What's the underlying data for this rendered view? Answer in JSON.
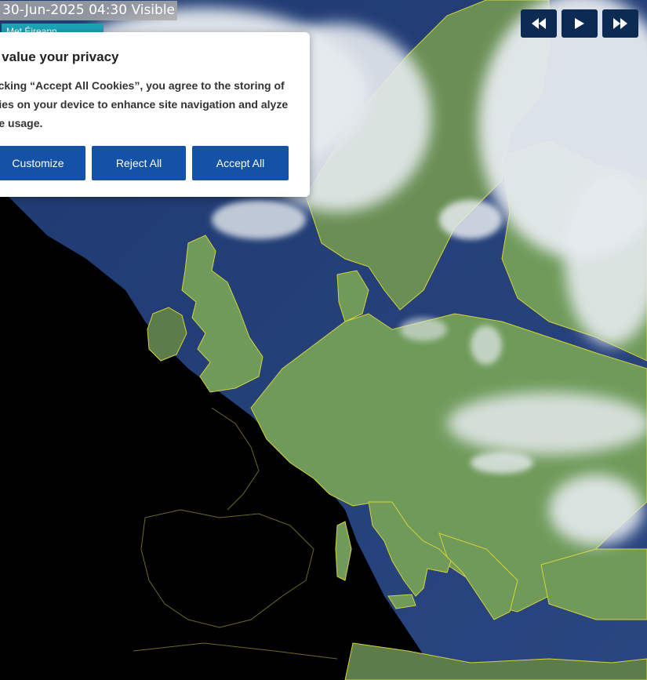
{
  "overlay": {
    "timestamp": "30-Jun-2025 04:30 Visible",
    "logo_text": "Met Éireann"
  },
  "controls": {
    "rewind_icon": "rewind-icon",
    "play_icon": "play-icon",
    "fast_forward_icon": "fast-forward-icon",
    "button_color": "#0d2b52"
  },
  "cookie_banner": {
    "title": "e value your privacy",
    "body": "clicking “Accept All Cookies”, you agree to the storing of okies on your device to enhance site navigation and alyze site usage.",
    "buttons": {
      "customize": "Customize",
      "reject": "Reject All",
      "accept": "Accept All"
    },
    "button_color": "#1452a8"
  },
  "map": {
    "colors": {
      "sea": "#233f78",
      "land": "#6f9a5a",
      "space": "#000000",
      "cloud": "#e6ebef",
      "coastline": "#e8e23a"
    }
  }
}
